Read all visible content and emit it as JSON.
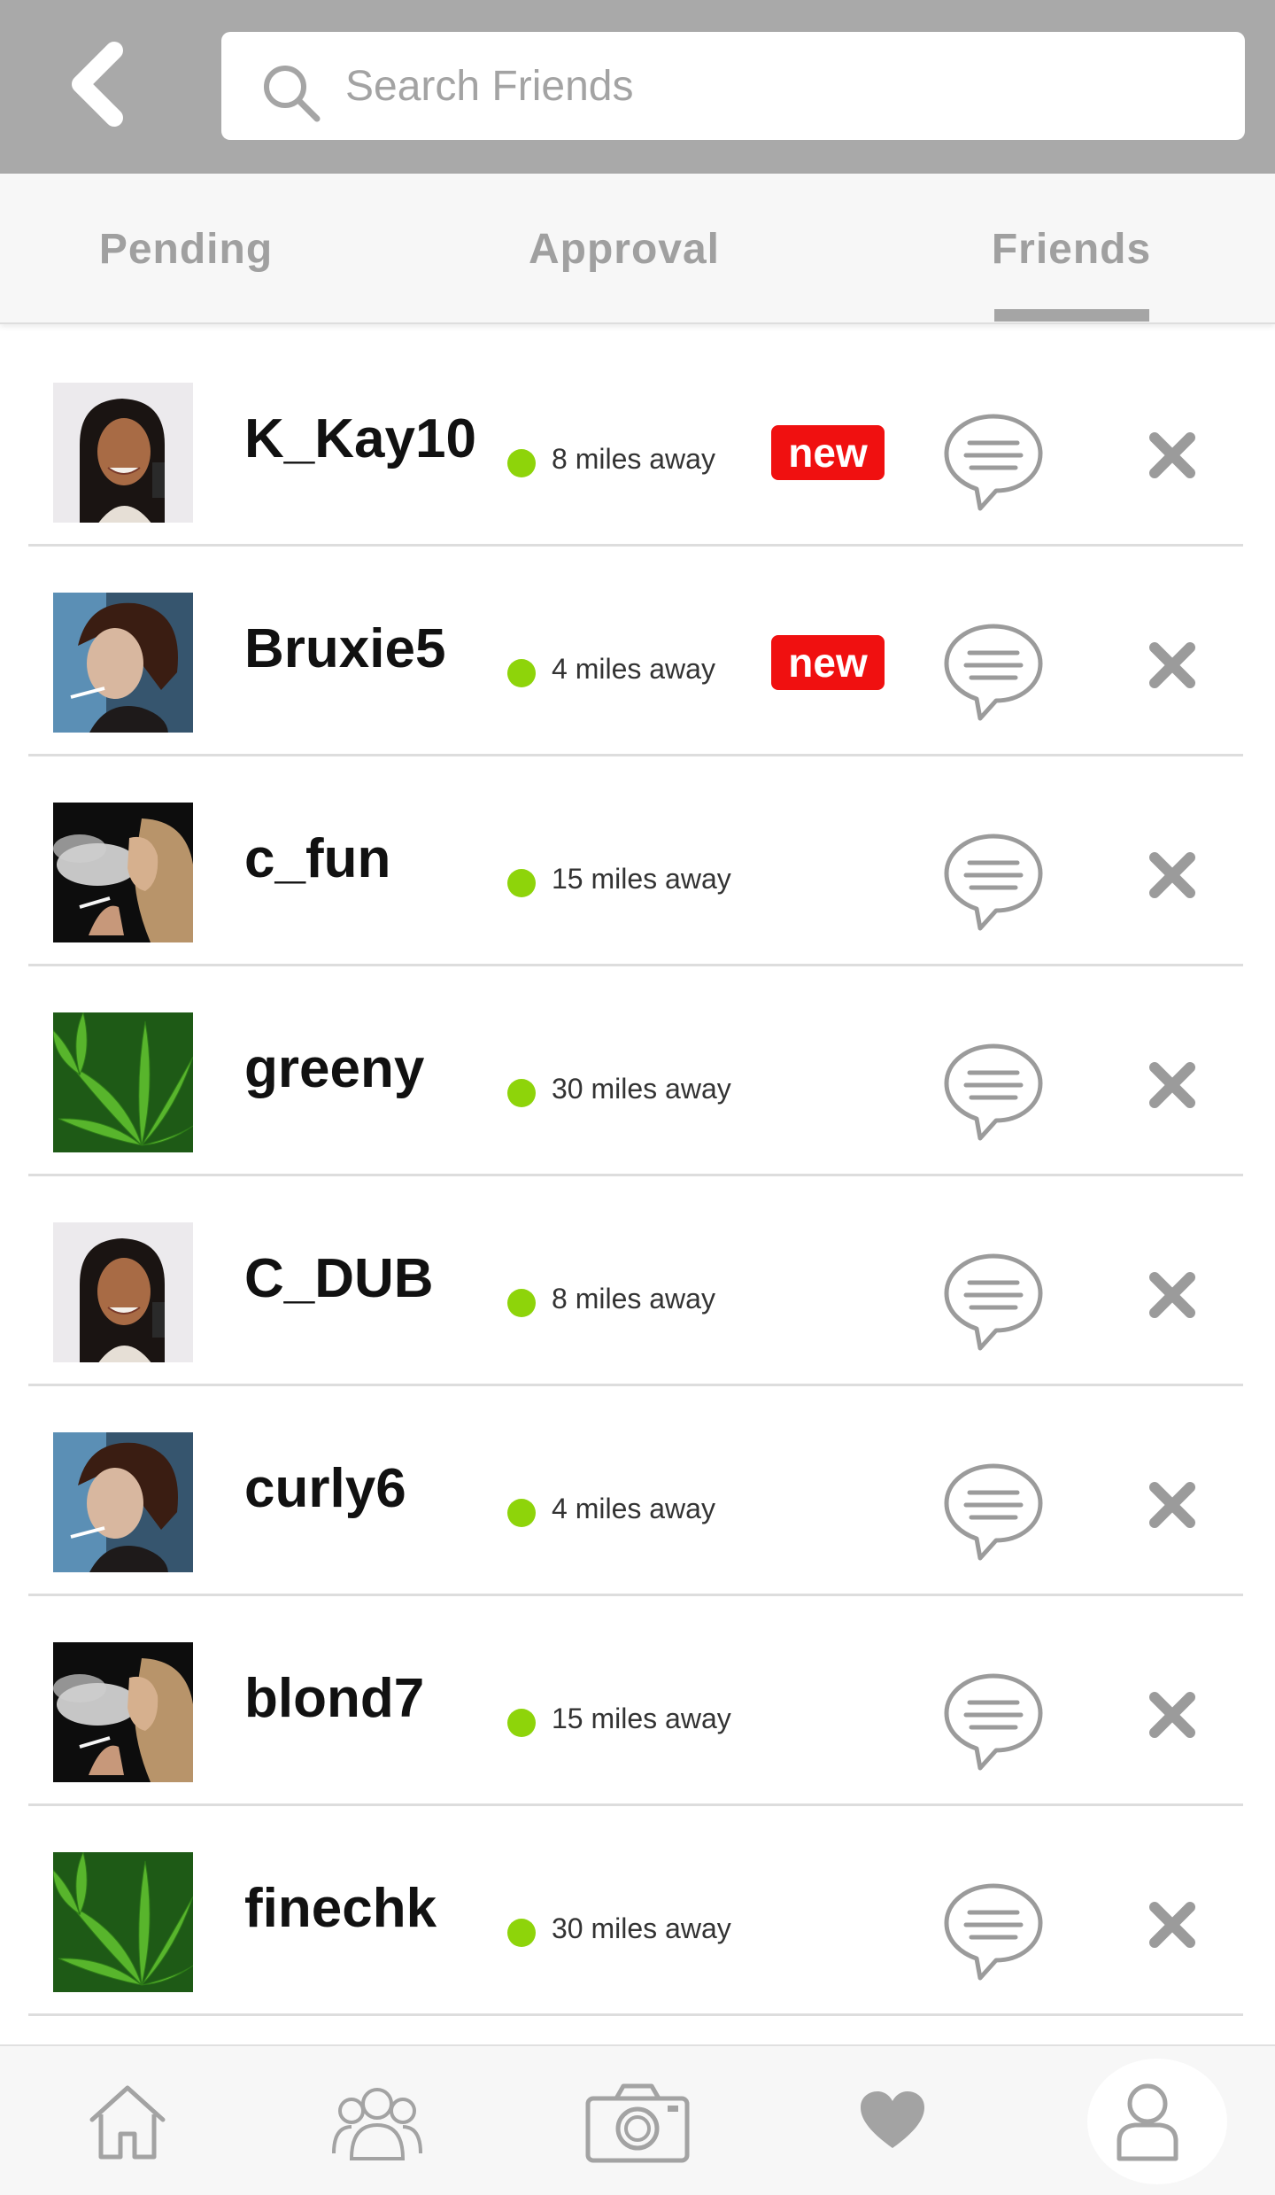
{
  "header": {
    "back_icon": "chevron-left-icon",
    "search": {
      "placeholder": "Search Friends",
      "icon": "search-icon"
    }
  },
  "tabs": [
    {
      "label": "Pending",
      "active": false
    },
    {
      "label": "Approval",
      "active": false
    },
    {
      "label": "Friends",
      "active": true
    }
  ],
  "friends": [
    {
      "username": "K_Kay10",
      "distance": "8 miles away",
      "badge": "new",
      "avatar": "woman-portrait",
      "online": true
    },
    {
      "username": "Bruxie5",
      "distance": "4 miles away",
      "badge": "new",
      "avatar": "woman-smoking",
      "online": true
    },
    {
      "username": "c_fun",
      "distance": "15 miles away",
      "badge": "",
      "avatar": "woman-smoke-profile",
      "online": true
    },
    {
      "username": "greeny",
      "distance": "30 miles away",
      "badge": "",
      "avatar": "green-leaf",
      "online": true
    },
    {
      "username": "C_DUB",
      "distance": "8 miles away",
      "badge": "",
      "avatar": "woman-portrait",
      "online": true
    },
    {
      "username": "curly6",
      "distance": "4 miles away",
      "badge": "",
      "avatar": "woman-smoking",
      "online": true
    },
    {
      "username": "blond7",
      "distance": "15 miles away",
      "badge": "",
      "avatar": "woman-smoke-profile",
      "online": true
    },
    {
      "username": "finechk",
      "distance": "30 miles away",
      "badge": "",
      "avatar": "green-leaf",
      "online": true
    }
  ],
  "bottom_nav": [
    {
      "icon": "home-icon"
    },
    {
      "icon": "group-icon"
    },
    {
      "icon": "camera-icon"
    },
    {
      "icon": "heart-icon"
    },
    {
      "icon": "profile-icon",
      "active": true
    }
  ],
  "colors": {
    "header_bg": "#a9a9a9",
    "status_online": "#8ed40a",
    "badge_new": "#f01010",
    "icon_gray": "#9b9b9b"
  }
}
